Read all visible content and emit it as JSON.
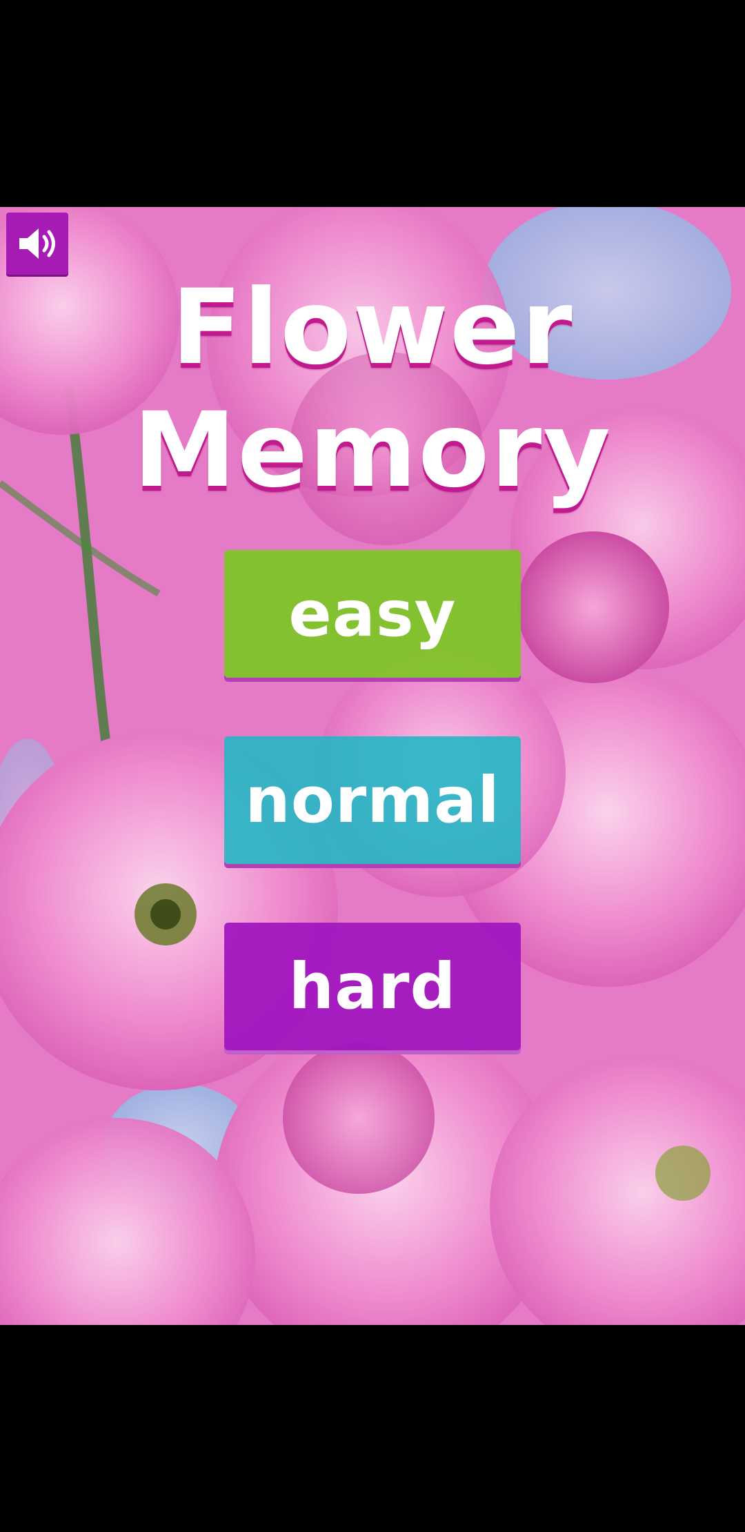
{
  "title": {
    "line1": "Flower",
    "line2": "Memory"
  },
  "sound": {
    "icon": "speaker-icon"
  },
  "levels": [
    {
      "label": "easy",
      "color": "#7dc625"
    },
    {
      "label": "normal",
      "color": "#25b7c4"
    },
    {
      "label": "hard",
      "color": "#a014be"
    }
  ],
  "colors": {
    "background": "#e36fc0",
    "title_shadow": "#c2198e",
    "sound_button": "#a51bb3"
  }
}
